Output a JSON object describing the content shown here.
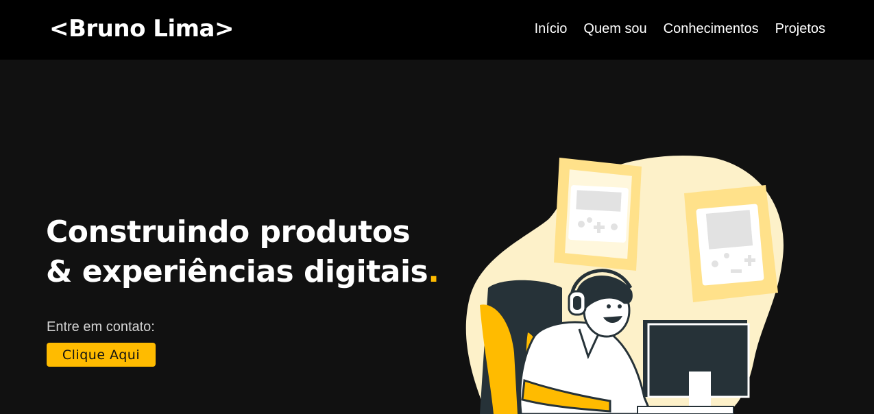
{
  "header": {
    "logo": "<Bruno Lima>",
    "nav": [
      {
        "label": "Início"
      },
      {
        "label": "Quem sou"
      },
      {
        "label": "Conhecimentos"
      },
      {
        "label": "Projetos"
      }
    ]
  },
  "hero": {
    "title_line1": "Construindo produtos",
    "title_line2": "& experiências digitais",
    "title_accent": ".",
    "contact_label": "Entre em contato:",
    "cta_label": "Clique Aqui"
  },
  "colors": {
    "background": "#111111",
    "navbar": "#000000",
    "accent": "#ffbb00",
    "text": "#ffffff"
  },
  "illustration": {
    "icons": [
      "handheld-game-console-icon",
      "handheld-game-console-icon",
      "gamer-with-headphones",
      "computer-monitor-icon",
      "gaming-chair"
    ]
  }
}
